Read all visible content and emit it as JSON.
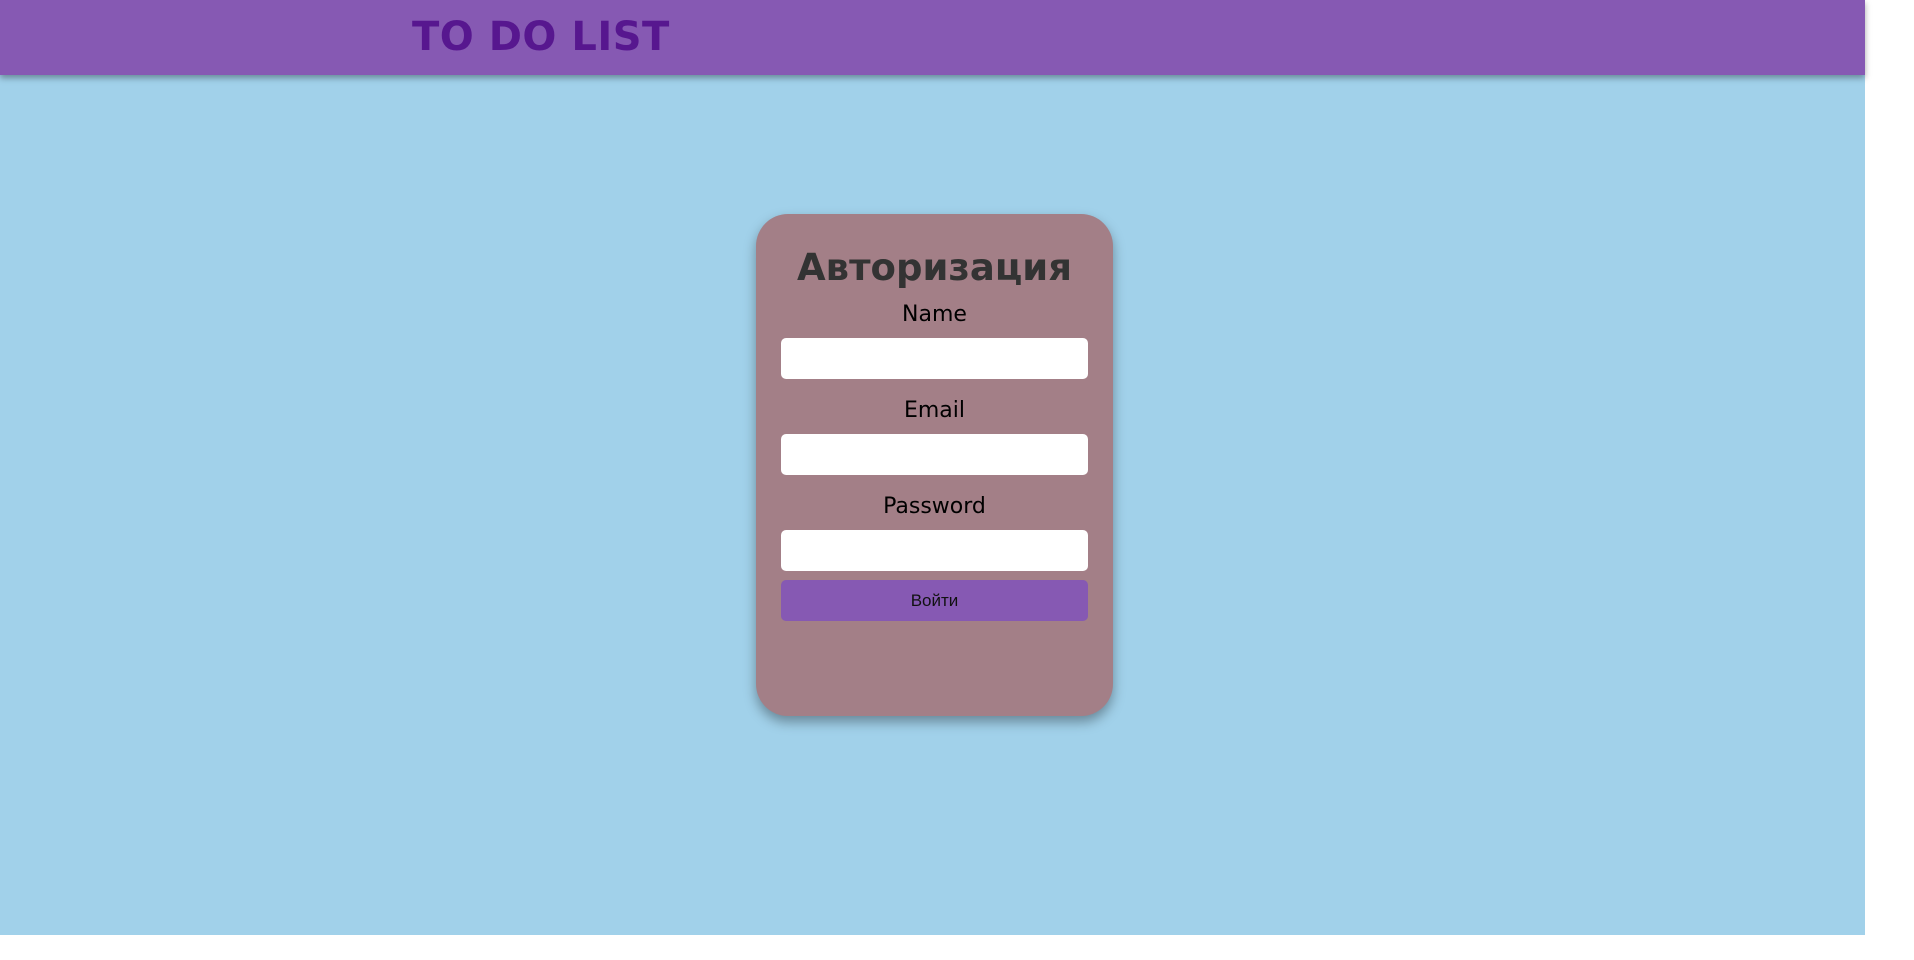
{
  "header": {
    "title": "TO DO LIST"
  },
  "login_card": {
    "title": "Авторизация",
    "fields": [
      {
        "label": "Name",
        "value": "",
        "placeholder": ""
      },
      {
        "label": "Email",
        "value": "",
        "placeholder": ""
      },
      {
        "label": "Password",
        "value": "",
        "placeholder": ""
      }
    ],
    "submit_label": "Войти"
  },
  "colors": {
    "page_background": "#a1d1ea",
    "header_background": "#8659b3",
    "header_title": "#57178f",
    "card_background": "#a37f87",
    "card_title": "#333333",
    "button_background": "#8659b3"
  }
}
